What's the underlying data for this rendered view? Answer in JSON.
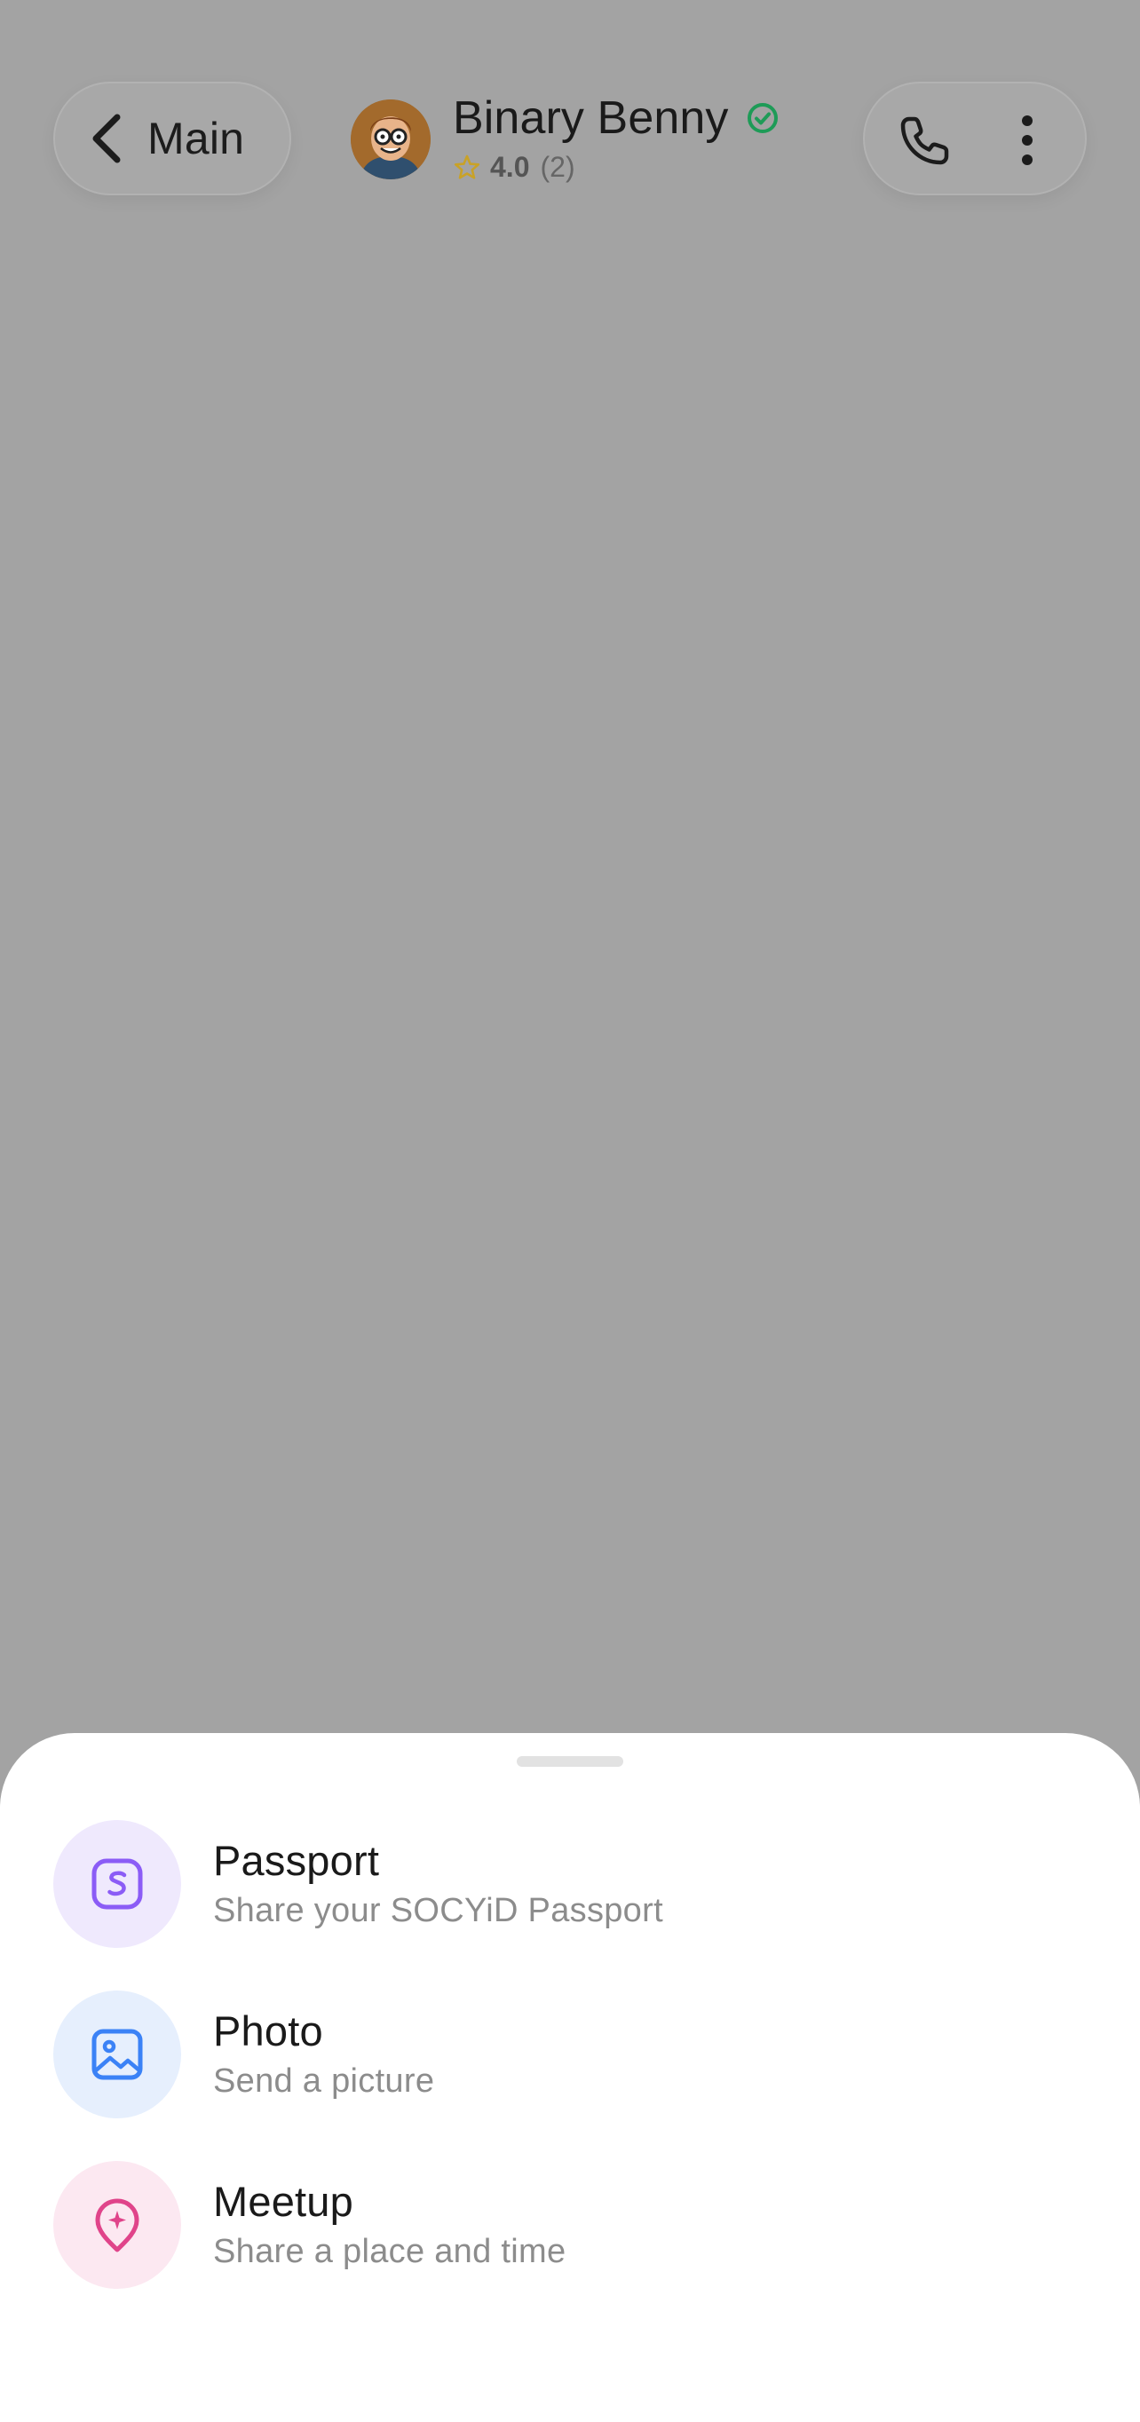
{
  "header": {
    "back_label": "Main",
    "contact_name": "Binary Benny",
    "rating_value": "4.0",
    "rating_count": "(2)",
    "rating": 4.0
  },
  "sheet": {
    "options": [
      {
        "title": "Passport",
        "subtitle": "Share your SOCYiD Passport",
        "icon": "passport-icon",
        "accent": "#8b5cf6",
        "bg": "#efe9fd"
      },
      {
        "title": "Photo",
        "subtitle": "Send a picture",
        "icon": "image-icon",
        "accent": "#3b82f6",
        "bg": "#e6effd"
      },
      {
        "title": "Meetup",
        "subtitle": "Share a place and time",
        "icon": "map-pin-icon",
        "accent": "#e0448a",
        "bg": "#fce8f1"
      }
    ]
  },
  "colors": {
    "verified": "#1e9b57",
    "star": "#c9a227",
    "overlay": "#a3a3a3"
  }
}
